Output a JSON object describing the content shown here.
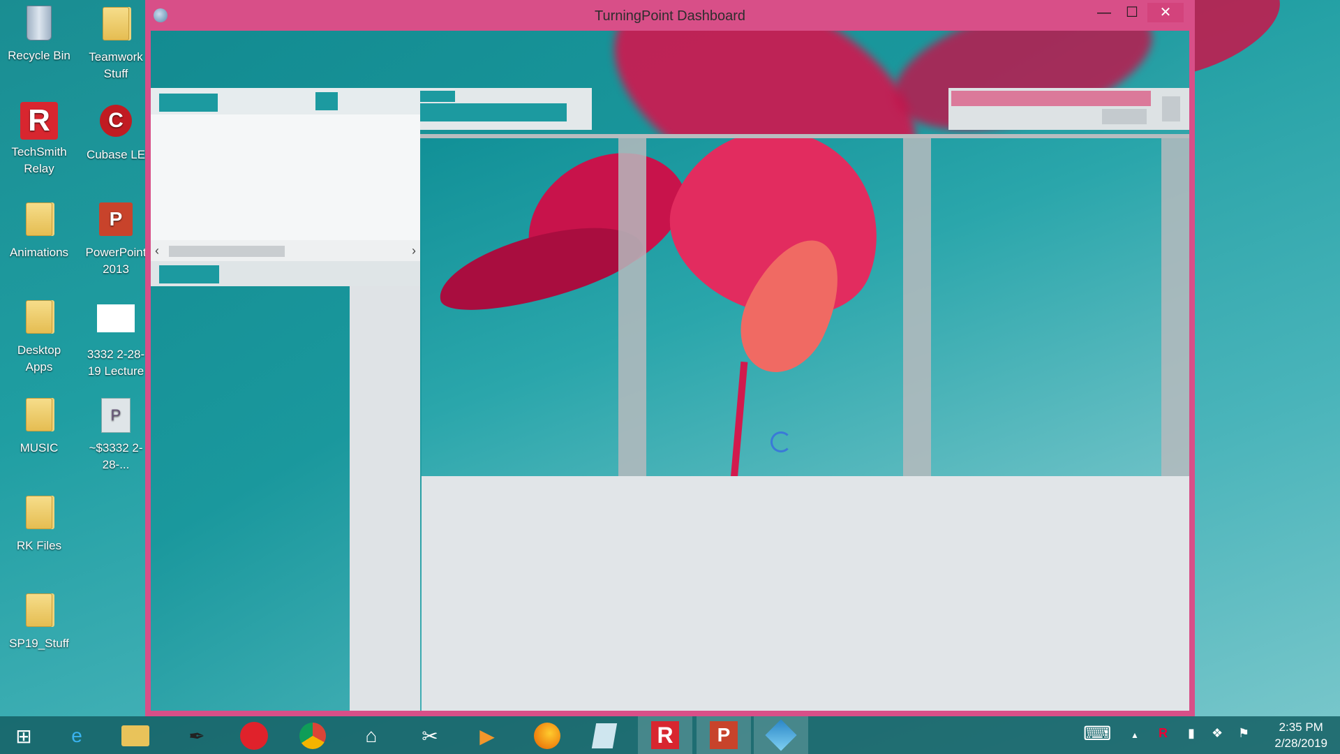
{
  "desktop": {
    "icons": [
      {
        "label": "Recycle Bin"
      },
      {
        "label": "Teamwork Stuff"
      },
      {
        "label": "TechSmith Relay"
      },
      {
        "label": "Cubase LE"
      },
      {
        "label": "Animations"
      },
      {
        "label": "PowerPoint 2013"
      },
      {
        "label": "Desktop Apps"
      },
      {
        "label": "3332 2-28-19 Lecture"
      },
      {
        "label": "MUSIC"
      },
      {
        "label": "~$3332 2-28-..."
      },
      {
        "label": "RK Files"
      },
      {
        "label": "SP19_Stuff"
      }
    ]
  },
  "window": {
    "title": "TurningPoint Dashboard",
    "minimize": "—",
    "maximize": "☐",
    "close": "✕"
  },
  "scrollbar": {
    "left_arrow": "‹",
    "right_arrow": "›"
  },
  "taskbar": {
    "start": "⊞",
    "apps": [
      "Internet Explorer",
      "File Explorer",
      "Pen",
      "Creative Cloud",
      "Chrome",
      "Home",
      "Snipping Tool",
      "Media Player",
      "Firefox",
      "Notepad",
      "TechSmith Relay",
      "PowerPoint",
      "TurningPoint"
    ],
    "tray": {
      "keyboard": "⌨",
      "chevron": "▲"
    },
    "time": "2:35 PM",
    "date": "2/28/2019"
  },
  "colors": {
    "window_frame": "#d84f88",
    "accent_teal": "#1c9aa0"
  }
}
